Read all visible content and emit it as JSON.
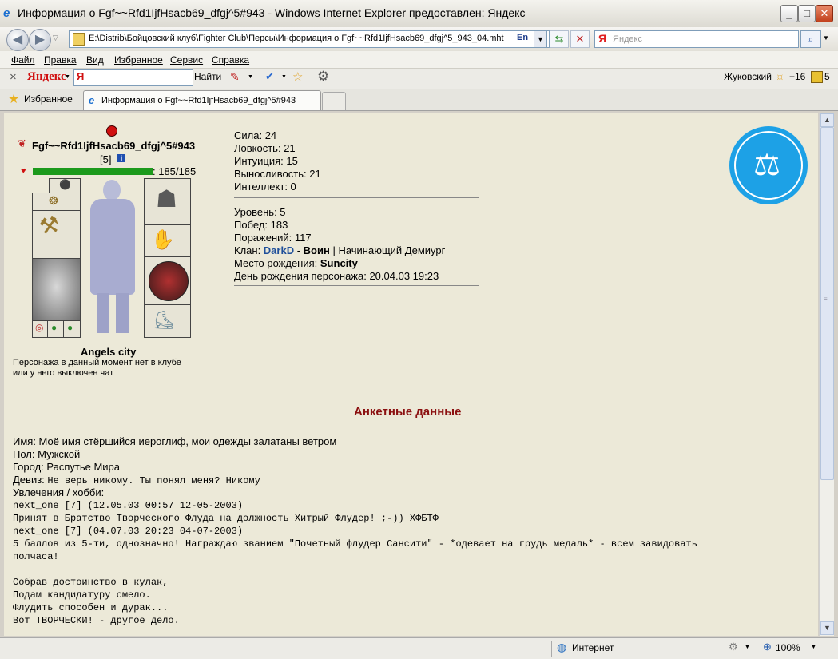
{
  "window": {
    "title": "Информация о Fgf~~Rfd1IjfHsacb69_dfgj^5#943 - Windows Internet Explorer предоставлен: Яндекс"
  },
  "nav": {
    "address": "E:\\Distrib\\Бойцовский клуб\\Fighter Club\\Персы\\Информация о Fgf~~Rfd1IjfHsacb69_dfgj^5_943_04.mht",
    "lang": "En",
    "search_placeholder": "Яндекс"
  },
  "menu": [
    "Файл",
    "Правка",
    "Вид",
    "Избранное",
    "Сервис",
    "Справка"
  ],
  "yandex_bar": {
    "close": "×",
    "logo": "Яндекс",
    "find_label": "Найти",
    "city": "Жуковский",
    "temp": "+16",
    "score": "5"
  },
  "tabs": {
    "favorites": "Избранное",
    "active": "Информация о Fgf~~Rfd1IjfHsacb69_dfgj^5#943"
  },
  "character": {
    "name": "Fgf~~Rfd1IjfHsacb69_dfgj^5#943",
    "level_badge": "[5]",
    "hp": ": 185/185",
    "hp_fraction": 1.0,
    "city": "Angels city",
    "offline_line1": "Персонажа в данный момент нет в клубе",
    "offline_line2": "или у него выключен чат"
  },
  "stats": [
    {
      "label": "Сила: ",
      "value": "24"
    },
    {
      "label": "Ловкость: ",
      "value": "21"
    },
    {
      "label": "Интуиция: ",
      "value": "15"
    },
    {
      "label": "Выносливость: ",
      "value": "21"
    },
    {
      "label": "Интеллект: ",
      "value": "0"
    }
  ],
  "info": {
    "level": "Уровень: 5",
    "wins": "Побед: 183",
    "losses": "Поражений: 117",
    "clan_prefix": "Клан: ",
    "clan_name": "DarkD",
    "clan_sep": " - ",
    "clan_role": "Воин",
    "clan_rank": " | Начинающий Демиург",
    "birthplace_prefix": "Место рождения: ",
    "birthplace": "Suncity",
    "birthday": "День рождения персонажа: 20.04.03 19:23"
  },
  "profile": {
    "heading": "Анкетные данные",
    "name": "Имя: Моё имя стёршийся иероглиф, мои одежды залатаны ветром",
    "gender": "Пол: Мужской",
    "city": "Город: Распутье Мира",
    "motto_label": "Девиз: ",
    "motto": "Не верь никому. Ты понял меня? Никому",
    "hobby_label": "Увлечения / хобби:",
    "lines": [
      "next_one [7]   (12.05.03 00:57 12-05-2003)",
      "Принят в Братство Творческого Флуда на должность Хитрый Флудер! ;-)) ХФБТФ",
      "next_one [7]   (04.07.03 20:23 04-07-2003)",
      "5 баллов из 5-ти, однозначно! Награждаю званием \"Почетный флудер Сансити\" - *одевает на грудь медаль* - всем завидовать",
      "полчаса!",
      "",
      "Собрав достоинство в кулак,",
      "Подам кандидатуру смело.",
      "Флудить способен и дурак...",
      "Вот ТВОРЧЕСКИ! - другое дело."
    ]
  },
  "status": {
    "zone": "Интернет",
    "zoom": "100%"
  },
  "colors": {
    "clan": "#1f4f9a",
    "heading": "#8b1010",
    "hp_bar": "#1c9a1c",
    "emblem": "#1da1e6"
  }
}
